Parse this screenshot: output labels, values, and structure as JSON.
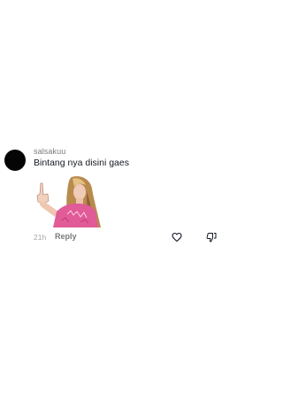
{
  "comment": {
    "username": "salsakuu",
    "text": "Bintang nya disini gaes",
    "timestamp": "21h",
    "reply_label": "Reply",
    "avatar_color": "#050505",
    "like_icon": "heart-outline-icon",
    "dislike_icon": "thumbs-down-icon",
    "sticker": "sticker-woman-pointing-up"
  }
}
